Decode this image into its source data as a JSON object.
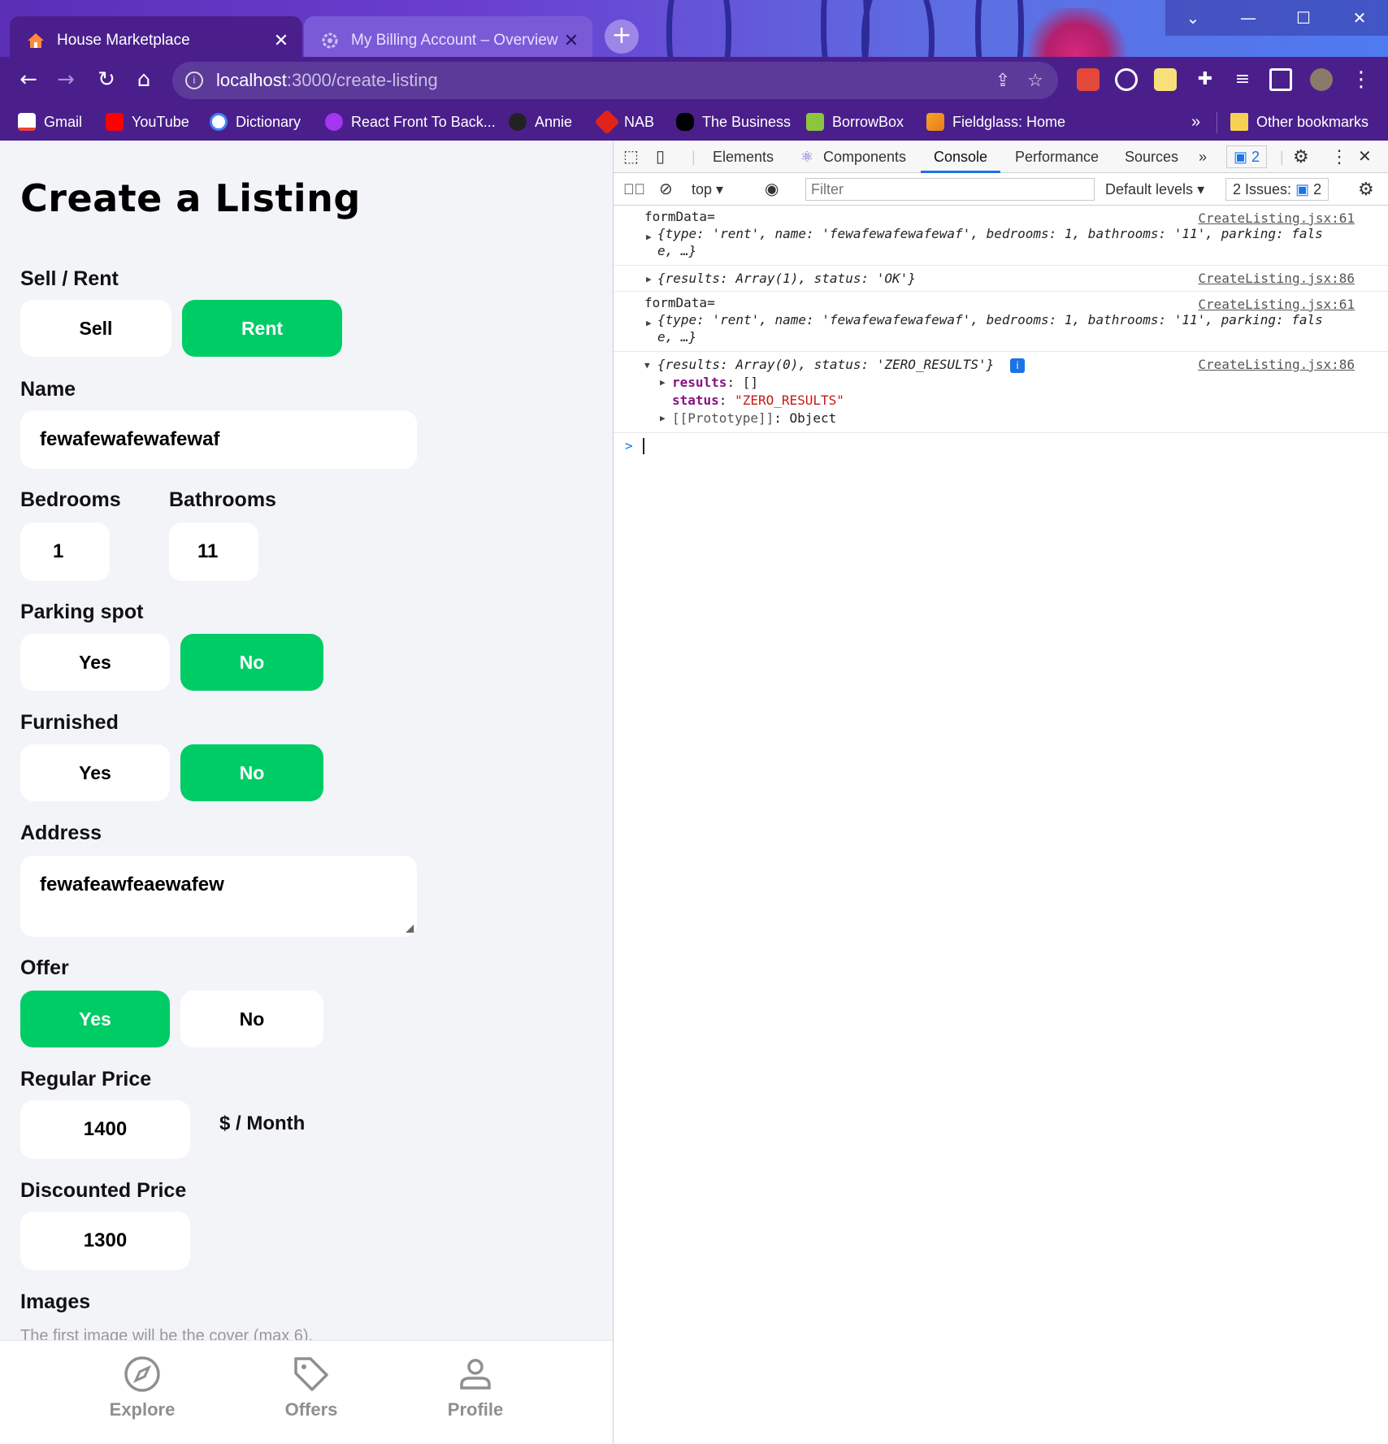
{
  "browser": {
    "tabs": [
      {
        "title": "House Marketplace",
        "favicon": "house-icon",
        "active": true
      },
      {
        "title": "My Billing Account – Overview –",
        "favicon": "gear-icon",
        "active": false
      }
    ],
    "new_tab": "+",
    "url": {
      "host": "localhost",
      "path": ":3000/create-listing"
    },
    "bookmarks": [
      {
        "label": "Gmail",
        "icon": "gmail-icon",
        "color": "#ea4335"
      },
      {
        "label": "YouTube",
        "icon": "youtube-icon",
        "color": "#ff0000"
      },
      {
        "label": "Dictionary",
        "icon": "google-icon",
        "color": "#4285f4"
      },
      {
        "label": "React Front To Back...",
        "icon": "udemy-icon",
        "color": "#a435f0"
      },
      {
        "label": "Annie",
        "icon": "github-icon",
        "color": "#222222"
      },
      {
        "label": "NAB",
        "icon": "nab-icon",
        "color": "#e2231a"
      },
      {
        "label": "The Business",
        "icon": "abc-icon",
        "color": "#000000"
      },
      {
        "label": "BorrowBox",
        "icon": "borrowbox-icon",
        "color": "#8cc63f"
      },
      {
        "label": "Fieldglass: Home",
        "icon": "fieldglass-icon",
        "color": "#f5a623"
      }
    ],
    "bookmarks_more": "»",
    "other_bookmarks": "Other bookmarks"
  },
  "form": {
    "title": "Create a Listing",
    "sell_rent": {
      "label": "Sell / Rent",
      "options": [
        "Sell",
        "Rent"
      ],
      "selected": "Rent"
    },
    "name": {
      "label": "Name",
      "value": "fewafewafewafewaf"
    },
    "bedrooms": {
      "label": "Bedrooms",
      "value": "1"
    },
    "bathrooms": {
      "label": "Bathrooms",
      "value": "11"
    },
    "parking": {
      "label": "Parking spot",
      "options": [
        "Yes",
        "No"
      ],
      "selected": "No"
    },
    "furnished": {
      "label": "Furnished",
      "options": [
        "Yes",
        "No"
      ],
      "selected": "No"
    },
    "address": {
      "label": "Address",
      "value": "fewafeawfeaewafew"
    },
    "offer": {
      "label": "Offer",
      "options": [
        "Yes",
        "No"
      ],
      "selected": "Yes"
    },
    "regular_price": {
      "label": "Regular Price",
      "value": "1400",
      "unit": "$ / Month"
    },
    "discounted_price": {
      "label": "Discounted Price",
      "value": "1300"
    },
    "images": {
      "label": "Images",
      "hint": "The first image will be the cover (max 6)."
    }
  },
  "bottom_nav": [
    {
      "label": "Explore",
      "icon": "compass-icon"
    },
    {
      "label": "Offers",
      "icon": "tag-icon"
    },
    {
      "label": "Profile",
      "icon": "person-icon"
    }
  ],
  "devtools": {
    "tabs": [
      "Elements",
      "Components",
      "Console",
      "Performance",
      "Sources"
    ],
    "selected_tab": "Console",
    "more": "»",
    "message_count": "2",
    "context": "top",
    "filter_placeholder": "Filter",
    "levels": "Default levels",
    "issues": "2 Issues:",
    "issues_count": "2",
    "console": [
      {
        "source": "CreateListing.jsx:61",
        "label": "formData=",
        "line1": "{type: 'rent', name: 'fewafewafewafewaf', bedrooms: 1, bathrooms: '11', parking: fals",
        "line2": "e, …}"
      },
      {
        "source": "CreateListing.jsx:86",
        "line1": "{results: Array(1), status: 'OK'}"
      },
      {
        "source": "CreateListing.jsx:61",
        "label": "formData=",
        "line1": "{type: 'rent', name: 'fewafewafewafewaf', bedrooms: 1, bathrooms: '11', parking: fals",
        "line2": "e, …}"
      },
      {
        "source": "CreateListing.jsx:86",
        "line1": "{results: Array(0), status: 'ZERO_RESULTS'}",
        "children": [
          {
            "key": "results",
            "value": "[]"
          },
          {
            "key": "status",
            "value": "\"ZERO_RESULTS\""
          },
          {
            "key": "[[Prototype]]",
            "value": "Object"
          }
        ]
      }
    ],
    "prompt": ">"
  }
}
